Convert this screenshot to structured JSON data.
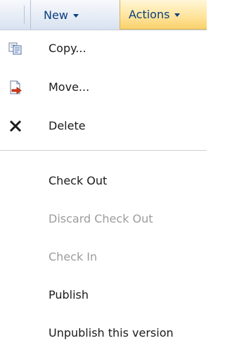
{
  "toolbar": {
    "new_label": "New",
    "actions_label": "Actions"
  },
  "menu": {
    "items": [
      {
        "label": "Copy...",
        "icon": "copy-icon",
        "enabled": true
      },
      {
        "label": "Move...",
        "icon": "move-icon",
        "enabled": true
      },
      {
        "label": "Delete",
        "icon": "delete-icon",
        "enabled": true
      },
      {
        "label": "Check Out",
        "enabled": true
      },
      {
        "label": "Discard Check Out",
        "enabled": false
      },
      {
        "label": "Check In",
        "enabled": false
      },
      {
        "label": "Publish",
        "enabled": true
      },
      {
        "label": "Unpublish this version",
        "enabled": true
      }
    ]
  },
  "colors": {
    "toolbar_text": "#0a3e80",
    "actions_highlight": "#ffe7a3",
    "disabled_text": "#9c9c9c"
  }
}
